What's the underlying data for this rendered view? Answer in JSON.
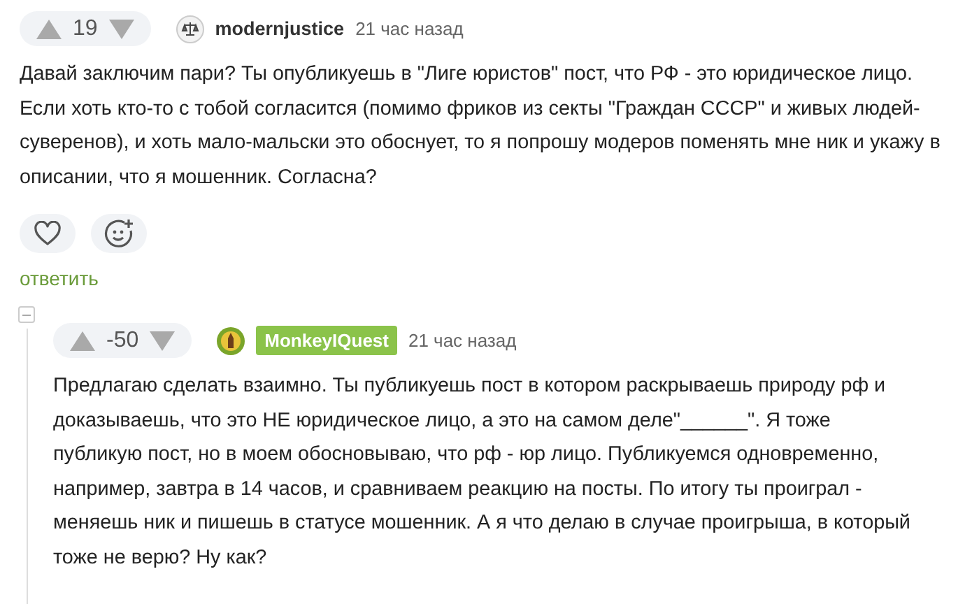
{
  "comments": [
    {
      "score": "19",
      "username": "modernjustice",
      "highlighted": false,
      "time": "21 час назад",
      "text": "Давай заключим пари? Ты опубликуешь в \"Лиге юристов\" пост, что РФ - это юридическое лицо. Если хоть кто-то с тобой согласится (помимо фриков из секты \"Граждан СССР\" и живых людей-суверенов), и хоть мало-мальски это обоснует, то я попрошу модеров поменять мне ник и укажу в описании, что я мошенник. Согласна?",
      "reply": "ответить",
      "avatar": {
        "kind": "scales"
      }
    },
    {
      "score": "-50",
      "username": "MonkeyIQuest",
      "highlighted": true,
      "time": "21 час назад",
      "text": "Предлагаю сделать взаимно. Ты публикуешь пост в котором раскрываешь природу рф и доказываешь, что это НЕ юридическое лицо, а это на самом деле\"______\". Я тоже публикую пост, но в моем обосновываю, что рф - юр лицо. Публикуемся одновременно, например, завтра в 14 часов, и сравниваем реакцию на посты. По итогу ты проиграл - меняешь ник и пишешь в статусе мошенник. А я что делаю в случае проигрыша, в который тоже не верю? Ну как?",
      "avatar": {
        "kind": "tower"
      }
    }
  ]
}
